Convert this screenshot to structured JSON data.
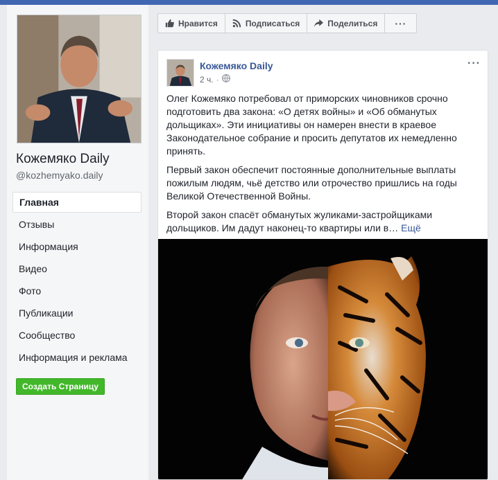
{
  "page": {
    "name": "Кожемяко Daily",
    "handle": "@kozhemyako.daily"
  },
  "nav": {
    "items": [
      "Главная",
      "Отзывы",
      "Информация",
      "Видео",
      "Фото",
      "Публикации",
      "Сообщество",
      "Информация и реклама"
    ],
    "active_index": 0
  },
  "create_page_button": "Создать Страницу",
  "actions": {
    "like": "Нравится",
    "follow": "Подписаться",
    "share": "Поделиться",
    "more": "···"
  },
  "post": {
    "author": "Кожемяко Daily",
    "time": "2 ч.",
    "separator": "·",
    "privacy_icon": "globe-icon",
    "menu": "···",
    "paragraphs": [
      "Олег Кожемяко потребовал от приморских чиновников срочно подготовить два закона: «О детях войны» и «Об обманутых дольщиках». Эти инициативы он намерен внести в краевое Законодательное собрание и просить депутатов их немедленно принять.",
      "Первый закон обеспечит постоянные дополнительные выплаты пожилым людям, чьё детство или отрочество пришлись на годы Великой Отечественной Войны.",
      "Второй закон спасёт обманутых жуликами-застройщиками дольщиков. Им дадут наконец-то квартиры или в…"
    ],
    "see_more": "Ещё"
  },
  "colors": {
    "brand": "#4267b2",
    "link": "#385898",
    "create_button": "#42b72a",
    "background": "#e9ebee"
  }
}
